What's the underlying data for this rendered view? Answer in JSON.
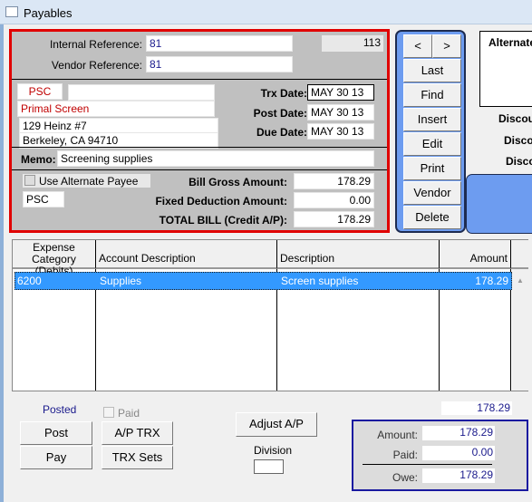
{
  "window": {
    "title": "Payables"
  },
  "header": {
    "internal_reference_label": "Internal Reference:",
    "internal_reference": "81",
    "record_number": "113",
    "vendor_reference_label": "Vendor Reference:",
    "vendor_reference": "81"
  },
  "vendor": {
    "code": "PSC",
    "extra": "",
    "name": "Primal Screen",
    "address1": "129 Heinz #7",
    "address2": "Berkeley, CA  94710"
  },
  "dates": {
    "trx_label": "Trx Date:",
    "trx": "MAY 30 13",
    "post_label": "Post Date:",
    "post": "MAY 30 13",
    "due_label": "Due Date:",
    "due": "MAY 30 13"
  },
  "memo": {
    "label": "Memo:",
    "value": "Screening supplies"
  },
  "payee": {
    "use_alternate_label": "Use Alternate Payee",
    "use_alternate_checked": false,
    "code": "PSC"
  },
  "amounts": {
    "gross_label": "Bill Gross Amount:",
    "gross": "178.29",
    "deduction_label": "Fixed Deduction Amount:",
    "deduction": "0.00",
    "total_label": "TOTAL BILL (Credit A/P):",
    "total": "178.29"
  },
  "nav_buttons": {
    "prev": "<",
    "next": ">",
    "items": [
      "Last",
      "Find",
      "Insert",
      "Edit",
      "Print",
      "Vendor",
      "Delete"
    ]
  },
  "right_panel": {
    "alternate_label": "Alternate",
    "discount_labels": [
      "Discou",
      "Disco",
      "Disco"
    ]
  },
  "colors": {
    "accent_blue": "#6d9cf0",
    "frame_red": "#e00000",
    "selection": "#3399ff"
  },
  "table": {
    "headers": [
      "Expense Category (Debits)",
      "Account Description",
      "Description",
      "Amount"
    ],
    "rows": [
      {
        "category": "6200",
        "account": "Supplies",
        "description": "Screen supplies",
        "amount": "178.29"
      }
    ]
  },
  "footer": {
    "status": "Posted",
    "paid_label": "Paid",
    "paid_checked": false,
    "post": "Post",
    "pay": "Pay",
    "ap_trx": "A/P TRX",
    "trx_sets": "TRX Sets",
    "adjust_ap": "Adjust A/P",
    "division_label": "Division",
    "division": "",
    "table_total": "178.29"
  },
  "summary": {
    "amount_label": "Amount:",
    "amount": "178.29",
    "paid_label": "Paid:",
    "paid": "0.00",
    "owe_label": "Owe:",
    "owe": "178.29"
  }
}
